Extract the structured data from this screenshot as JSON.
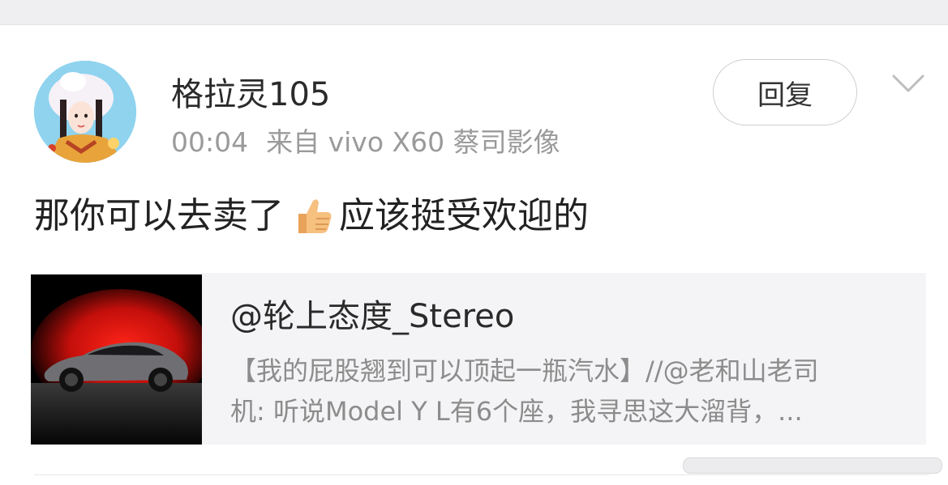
{
  "post": {
    "username": "格拉灵105",
    "time": "00:04",
    "source": "来自 vivo X60 蔡司影像",
    "reply_label": "回复",
    "content_before_emoji": "那你可以去卖了",
    "emoji": "thumbs-up-icon",
    "content_after_emoji": "应该挺受欢迎的"
  },
  "repost": {
    "author": "@轮上态度_Stereo",
    "text_line1": "【我的屁股翘到可以顶起一瓶汽水】//@老和山老司",
    "text_line2": "机: 听说Model Y L有6个座，我寻思这大溜背，..."
  },
  "icons": {
    "more": "chevron-down-icon",
    "avatar": "avatar",
    "repost_image": "car-image"
  },
  "colors": {
    "background": "#ffffff",
    "top_strip": "#efeff1",
    "repost_bg": "#f4f4f6",
    "meta_text": "#9a9a9a"
  }
}
